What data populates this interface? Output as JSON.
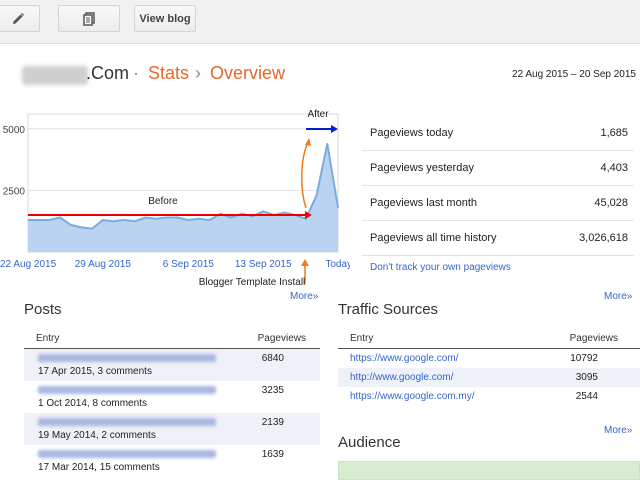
{
  "toolbar": {
    "edit_icon": "pencil-icon",
    "pages_icon": "pages-icon",
    "view_blog_label": "View blog"
  },
  "header": {
    "blog_name_suffix": ".Com",
    "separator1": "·",
    "crumb_stats": "Stats",
    "separator2": "›",
    "crumb_overview": "Overview",
    "date_range": "22 Aug 2015 – 20 Sep 2015"
  },
  "chart_data": {
    "type": "area",
    "x": [
      "22 Aug 2015",
      "23 Aug",
      "24 Aug",
      "25 Aug",
      "26 Aug",
      "27 Aug",
      "28 Aug",
      "29 Aug 2015",
      "30 Aug",
      "31 Aug",
      "1 Sep",
      "2 Sep",
      "3 Sep",
      "4 Sep",
      "5 Sep",
      "6 Sep 2015",
      "7 Sep",
      "8 Sep",
      "9 Sep",
      "10 Sep",
      "11 Sep",
      "12 Sep",
      "13 Sep 2015",
      "14 Sep",
      "15 Sep",
      "16 Sep",
      "17 Sep",
      "18 Sep",
      "19 Sep",
      "Today"
    ],
    "values": [
      1300,
      1300,
      1300,
      1400,
      1100,
      1000,
      950,
      1300,
      1250,
      1300,
      1250,
      1400,
      1350,
      1400,
      1400,
      1300,
      1350,
      1300,
      1550,
      1400,
      1550,
      1450,
      1650,
      1500,
      1600,
      1500,
      1350,
      2300,
      4400,
      1800
    ],
    "tick_labels": [
      "22 Aug 2015",
      "29 Aug 2015",
      "6 Sep 2015",
      "13 Sep 2015",
      "Today"
    ],
    "y_ticks": [
      2500,
      5000
    ],
    "ylim": [
      0,
      5600
    ],
    "color": "#7cabe0",
    "annotations": {
      "before": "Before",
      "after": "After",
      "install": "Blogger Template Install"
    },
    "legend": "none",
    "grid": true
  },
  "stats": [
    {
      "label": "Pageviews today",
      "value": "1,685"
    },
    {
      "label": "Pageviews yesterday",
      "value": "4,403"
    },
    {
      "label": "Pageviews last month",
      "value": "45,028"
    },
    {
      "label": "Pageviews all time history",
      "value": "3,026,618"
    }
  ],
  "dont_track": "Don't track your own pageviews",
  "more": "More»",
  "posts": {
    "title": "Posts",
    "col_entry": "Entry",
    "col_pageviews": "Pageviews",
    "rows": [
      {
        "meta": "17 Apr 2015, 3 comments",
        "pageviews": "6840"
      },
      {
        "meta": "1 Oct 2014, 8 comments",
        "pageviews": "3235"
      },
      {
        "meta": "19 May 2014, 2 comments",
        "pageviews": "2139"
      },
      {
        "meta": "17 Mar 2014, 15 comments",
        "pageviews": "1639"
      }
    ]
  },
  "traffic": {
    "title": "Traffic Sources",
    "col_entry": "Entry",
    "col_pageviews": "Pageviews",
    "rows": [
      {
        "url": "https://www.google.com/",
        "pageviews": "10792"
      },
      {
        "url": "http://www.google.com/",
        "pageviews": "3095"
      },
      {
        "url": "https://www.google.com.my/",
        "pageviews": "2544"
      }
    ]
  },
  "audience": {
    "title": "Audience"
  }
}
